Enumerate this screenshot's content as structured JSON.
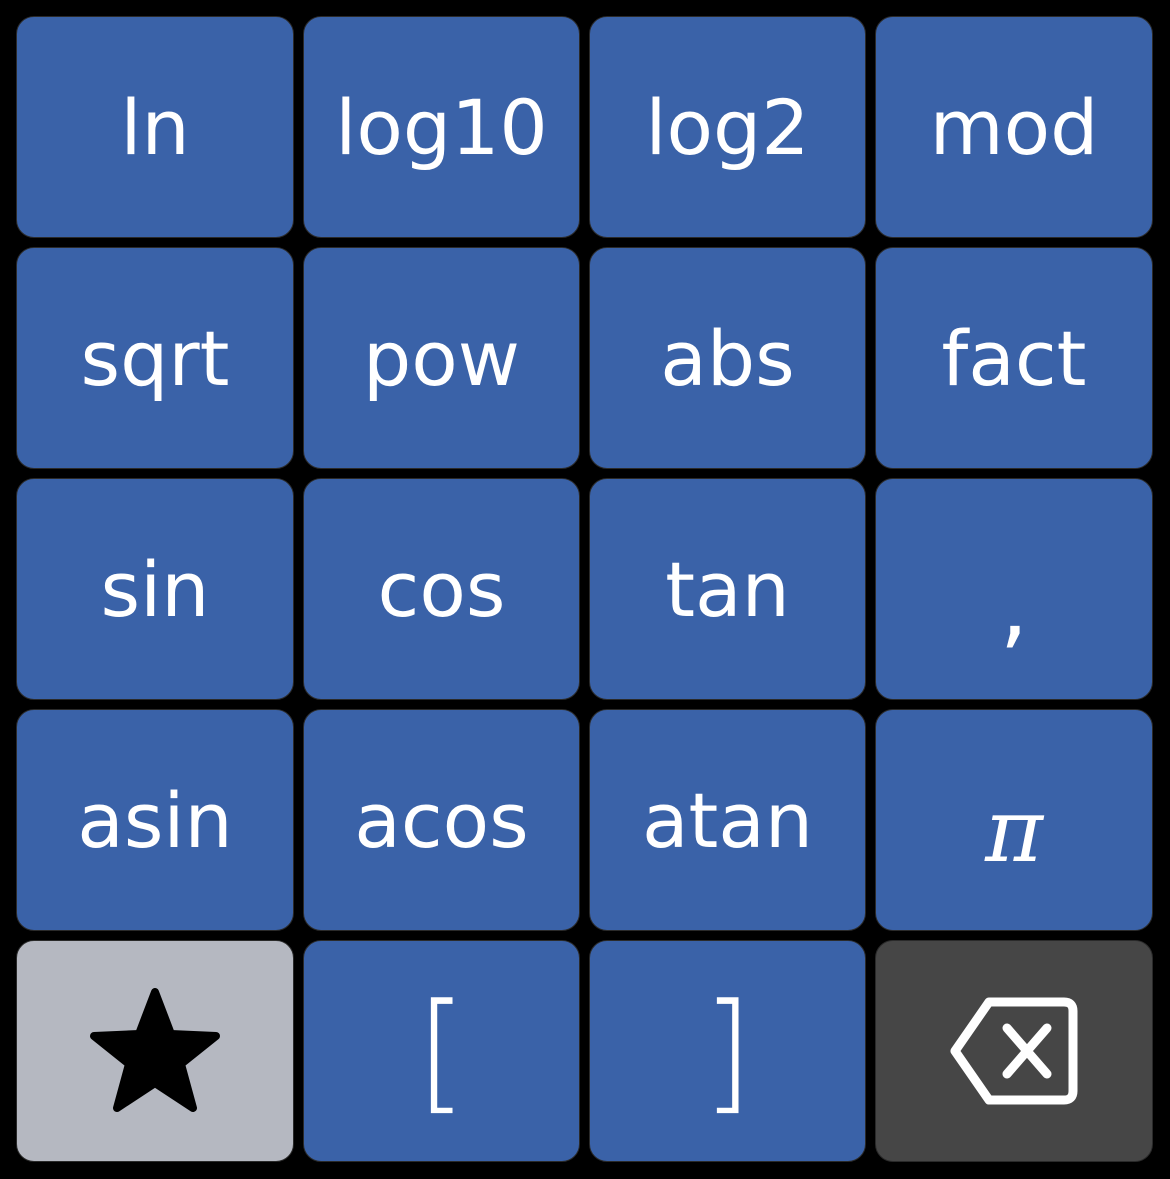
{
  "keypad": {
    "rows": [
      [
        "ln",
        "log10",
        "log2",
        "mod"
      ],
      [
        "sqrt",
        "pow",
        "abs",
        "fact"
      ],
      [
        "sin",
        "cos",
        "tan",
        ","
      ],
      [
        "asin",
        "acos",
        "atan",
        "π"
      ]
    ],
    "bottom": {
      "favorite_icon": "star-icon",
      "open_bracket": "[",
      "close_bracket": "]",
      "backspace_icon": "backspace-icon"
    }
  },
  "colors": {
    "function_key": "#3A62A8",
    "favorite_key": "#B5B8C1",
    "backspace_key": "#464646",
    "background": "#000000"
  }
}
